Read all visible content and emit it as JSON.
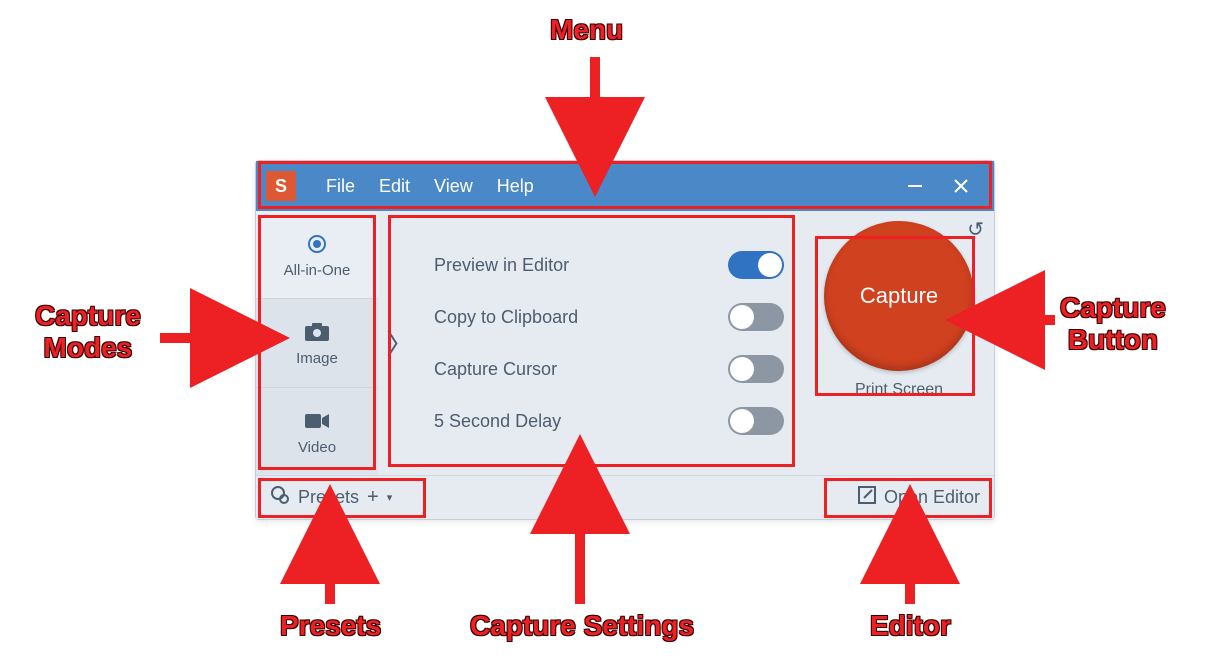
{
  "menu": {
    "items": [
      "File",
      "Edit",
      "View",
      "Help"
    ],
    "logo_letter": "S"
  },
  "modes": [
    {
      "id": "all-in-one",
      "label": "All-in-One",
      "icon": "target"
    },
    {
      "id": "image",
      "label": "Image",
      "icon": "camera"
    },
    {
      "id": "video",
      "label": "Video",
      "icon": "video"
    }
  ],
  "active_mode": "all-in-one",
  "settings": [
    {
      "label": "Preview in Editor",
      "on": true
    },
    {
      "label": "Copy to Clipboard",
      "on": false
    },
    {
      "label": "Capture Cursor",
      "on": false
    },
    {
      "label": "5 Second Delay",
      "on": false
    }
  ],
  "capture": {
    "button_label": "Capture",
    "hotkey_label": "Print Screen"
  },
  "bottom": {
    "presets_label": "Presets",
    "open_editor_label": "Open Editor"
  },
  "annotations": {
    "menu": "Menu",
    "capture_modes": "Capture\nModes",
    "capture_button": "Capture\nButton",
    "presets": "Presets",
    "capture_settings": "Capture Settings",
    "editor": "Editor"
  },
  "colors": {
    "accent_red": "#ed2024",
    "capture_red": "#d0411f",
    "menu_blue": "#4a88c7",
    "toggle_on": "#2f73c2",
    "toggle_off": "#8d97a3"
  }
}
